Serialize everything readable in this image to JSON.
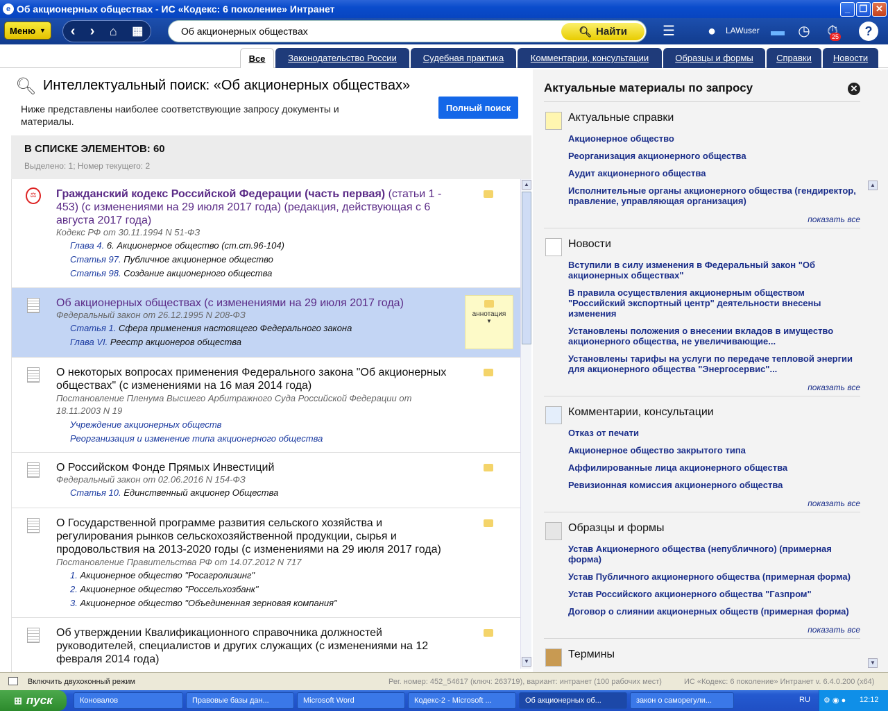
{
  "window": {
    "title": "Об акционерных обществах - ИС «Кодекс: 6 поколение» Интранет",
    "min": "_",
    "max": "❐",
    "close": "✕"
  },
  "toolbar": {
    "menu_label": "Меню",
    "search_value": "Об акционерных обществах",
    "find_label": "Найти",
    "username": "LAWuser",
    "badge": "25"
  },
  "tabs": [
    "Все",
    "Законодательство России",
    "Судебная практика",
    "Комментарии, консультации",
    "Образцы и формы",
    "Справки",
    "Новости"
  ],
  "header": {
    "title": "Интеллектуальный поиск: «Об акционерных обществах»",
    "desc": "Ниже представлены наиболее соответствующие запросу документы и материалы.",
    "full_search": "Полный поиск"
  },
  "list": {
    "count_label": "В СПИСКЕ ЭЛЕМЕНТОВ: 60",
    "sub_label": "Выделено: 1; Номер текущего: 2",
    "annotation": "аннотация",
    "items": [
      {
        "title_bold": "Гражданский кодекс Российской Федерации (часть первая)",
        "title_rest": " (статьи 1 - 453) (с изменениями на 29 июля 2017 года) (редакция, действующая с 6 августа 2017 года)",
        "meta": "Кодекс РФ от 30.11.1994 N 51-ФЗ",
        "subs": [
          [
            "Глава 4.",
            " 6. Акционерное общество (ст.ст.96-104)"
          ],
          [
            "Статья 97.",
            " Публичное акционерное общество"
          ],
          [
            "Статья 98.",
            " Создание акционерного общества"
          ]
        ]
      },
      {
        "title": "Об акционерных обществах (с изменениями на 29 июля 2017 года)",
        "meta": "Федеральный закон от 26.12.1995 N 208-ФЗ",
        "subs": [
          [
            "Статья 1.",
            " Сфера применения настоящего Федерального закона"
          ],
          [
            "Глава VI.",
            " Реестр акционеров общества"
          ]
        ]
      },
      {
        "title": "О некоторых вопросах применения Федерального закона \"Об акционерных обществах\" (с изменениями на 16 мая 2014 года)",
        "meta": "Постановление Пленума Высшего Арбитражного Суда Российской Федерации от 18.11.2003 N 19",
        "subs": [
          [
            "Учреждение акционерных обществ",
            ""
          ],
          [
            "Реорганизация и изменение типа акционерного общества",
            ""
          ]
        ]
      },
      {
        "title": "О Российском Фонде Прямых Инвестиций",
        "meta": "Федеральный закон от 02.06.2016 N 154-ФЗ",
        "subs": [
          [
            "Статья 10.",
            " Единственный акционер Общества"
          ]
        ]
      },
      {
        "title": "О Государственной программе развития сельского хозяйства и регулирования рынков сельскохозяйственной продукции, сырья и продовольствия на 2013-2020 годы (с изменениями на 29 июля 2017 года)",
        "meta": "Постановление Правительства РФ от 14.07.2012 N 717",
        "subs": [
          [
            "1.",
            " Акционерное общество \"Росагролизинг\""
          ],
          [
            "2.",
            " Акционерное общество \"Россельхозбанк\""
          ],
          [
            "3.",
            " Акционерное общество \"Объединенная зерновая компания\""
          ]
        ]
      },
      {
        "title": "Об утверждении Квалификационного справочника должностей руководителей, специалистов и других служащих (с изменениями на 12 февраля 2014 года)",
        "meta": "",
        "subs": []
      }
    ]
  },
  "right": {
    "title": "Актуальные материалы по запросу",
    "show_all": "показать все",
    "sections": [
      {
        "title": "Актуальные справки",
        "links": [
          "Акционерное общество",
          "Реорганизация акционерного общества",
          "Аудит акционерного общества",
          "Исполнительные органы акционерного общества (гендиректор, правление, управляющая организация)"
        ]
      },
      {
        "title": "Новости",
        "links": [
          "Вступили в силу изменения в Федеральный закон \"Об акционерных обществах\"",
          "В правила осуществления акционерным обществом \"Российский экспортный центр\" деятельности внесены изменения",
          "Установлены положения о внесении вкладов в имущество акционерного общества, не увеличивающие...",
          "Установлены тарифы на услуги по передаче тепловой энергии для акционерного общества \"Энергосервис\"..."
        ]
      },
      {
        "title": "Комментарии, консультации",
        "links": [
          "Отказ от печати",
          "Акционерное общество закрытого типа",
          "Аффилированные лица акционерного общества",
          "Ревизионная комиссия акционерного общества"
        ]
      },
      {
        "title": "Образцы и формы",
        "links": [
          "Устав Акционерного общества (непубличного) (примерная форма)",
          "Устав Публичного акционерного общества (примерная форма)",
          "Устав Российского акционерного общества \"Газпром\"",
          "Договор о слиянии акционерных обществ (примерная форма)"
        ]
      },
      {
        "title": "Термины",
        "links": []
      }
    ]
  },
  "status": {
    "dual_mode": "Включить двухоконный режим",
    "reg": "Рег. номер: 452_54617 (ключ: 263719), вариант: интранет (100 рабочих мест)",
    "version": "ИС «Кодекс: 6 поколение» Интранет v. 6.4.0.200 (x64)"
  },
  "taskbar": {
    "start": "пуск",
    "tasks": [
      "Коновалов",
      "Правовые базы дан...",
      "Microsoft Word",
      "Кодекс-2 - Microsoft ...",
      "Об акционерных об...",
      "закон о саморегули..."
    ],
    "lang": "RU",
    "clock": "12:12"
  }
}
